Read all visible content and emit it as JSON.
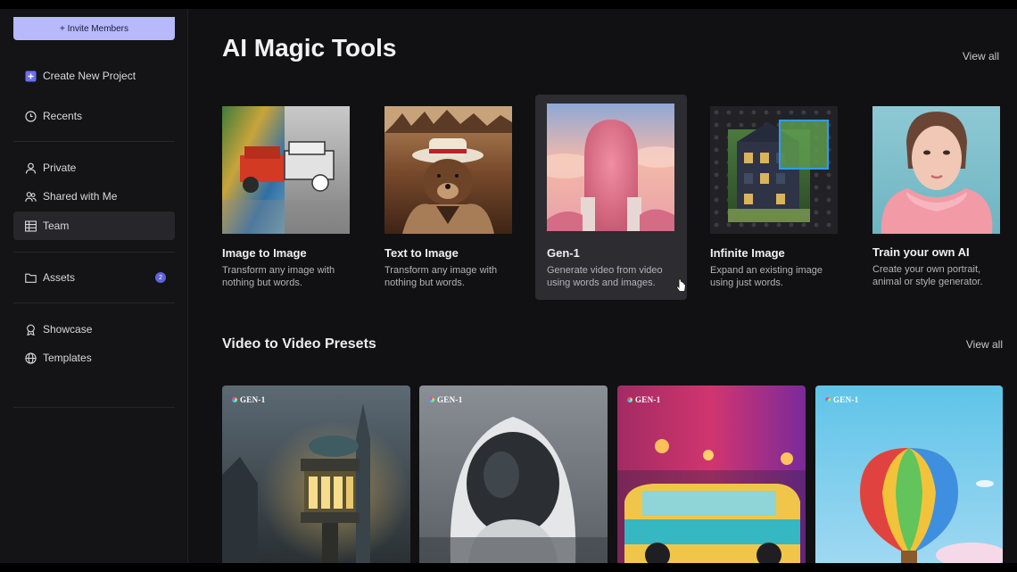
{
  "sidebar": {
    "invite_label": "+ Invite Members",
    "items": [
      {
        "label": "Create New Project",
        "icon": "plus-square-icon"
      },
      {
        "label": "Recents",
        "icon": "clock-icon"
      },
      {
        "label": "Private",
        "icon": "user-icon"
      },
      {
        "label": "Shared with Me",
        "icon": "users-icon"
      },
      {
        "label": "Team",
        "icon": "grid-icon",
        "active": true
      },
      {
        "label": "Assets",
        "icon": "folder-icon",
        "badge": "2"
      },
      {
        "label": "Showcase",
        "icon": "award-icon"
      },
      {
        "label": "Templates",
        "icon": "globe-icon"
      }
    ]
  },
  "main": {
    "title": "AI Magic Tools",
    "view_all": "View all",
    "tools": [
      {
        "name": "Image to Image",
        "desc": "Transform any image with nothing but words."
      },
      {
        "name": "Text to Image",
        "desc": "Transform any image with nothing but words."
      },
      {
        "name": "Gen-1",
        "desc": "Generate video from video using words and images.",
        "highlighted": true
      },
      {
        "name": "Infinite Image",
        "desc": "Expand an existing image using just words."
      },
      {
        "name": "Train your own AI",
        "desc": "Create your own portrait, animal or style generator."
      }
    ],
    "presets_title": "Video to Video Presets",
    "presets_view_all": "View all",
    "presets": [
      {
        "tag": "GEN-1"
      },
      {
        "tag": "GEN-1"
      },
      {
        "tag": "GEN-1"
      },
      {
        "tag": "GEN-1"
      }
    ]
  },
  "colors": {
    "background": "#111113",
    "accent": "#b7b9fb",
    "active_item": "#27272b"
  }
}
